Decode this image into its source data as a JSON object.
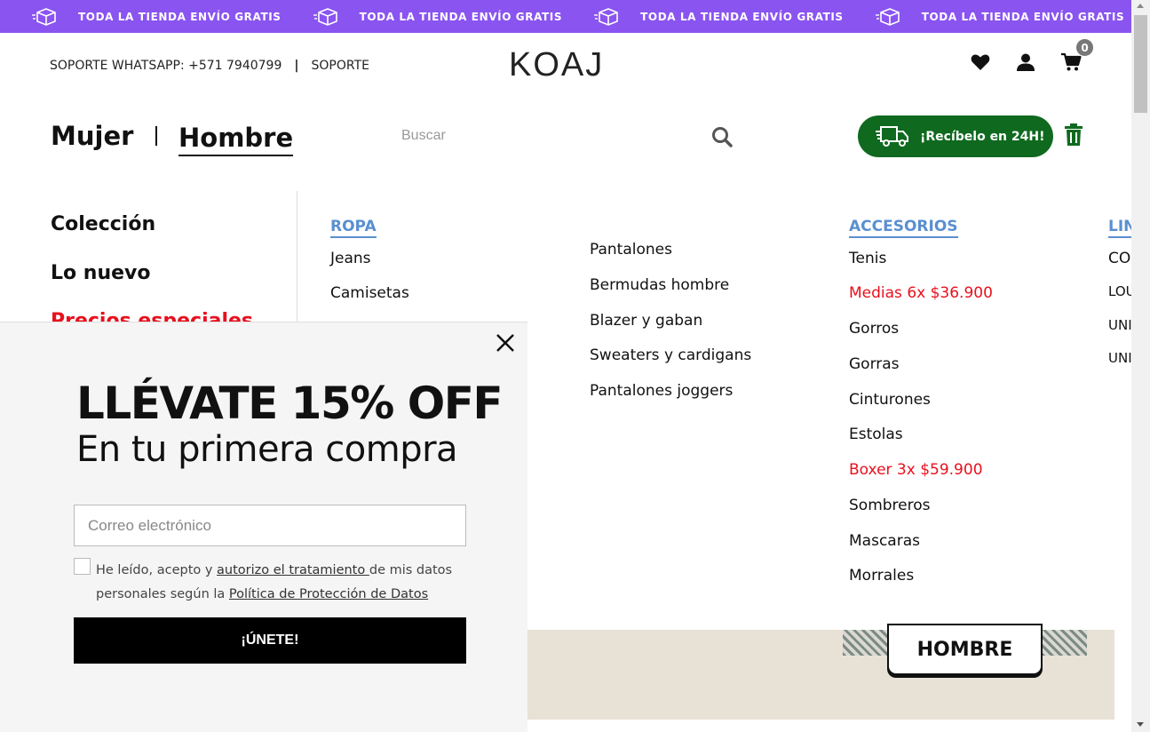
{
  "promo": {
    "items": [
      {
        "text": "TODA LA TIENDA ENVÍO GRATIS"
      },
      {
        "text": "TODA LA TIENDA ENVÍO GRATIS"
      },
      {
        "text": "TODA LA TIENDA ENVÍO GRATIS"
      },
      {
        "text": "TODA LA TIENDA ENVÍO GRATIS"
      }
    ],
    "background": "#8a54f0"
  },
  "header": {
    "support_whatsapp": "SOPORTE WHATSAPP: +571 7940799",
    "separator": "|",
    "support_link": "SOPORTE",
    "logo": "KOAJ",
    "cart_count": "0"
  },
  "nav": {
    "mujer": "Mujer",
    "hombre": "Hombre",
    "search_placeholder": "Buscar",
    "delivery_label": "¡Recíbelo en 24H!",
    "delivery_color": "#0f6a1f"
  },
  "sidebar": {
    "items": [
      {
        "label": "Colección"
      },
      {
        "label": "Lo nuevo"
      },
      {
        "label": "Precios especiales"
      }
    ]
  },
  "menu": {
    "ropa": {
      "heading": "ROPA",
      "col1": [
        "Jeans",
        "Camisetas"
      ],
      "col2": [
        "Pantalones",
        "Bermudas hombre",
        "Blazer y gaban",
        "Sweaters y cardigans",
        "Pantalones joggers"
      ]
    },
    "accesorios": {
      "heading": "ACCESORIOS",
      "items": [
        {
          "label": "Tenis",
          "highlight": false
        },
        {
          "label": "Medias 6x $36.900",
          "highlight": true
        },
        {
          "label": "Gorros",
          "highlight": false
        },
        {
          "label": "Gorras",
          "highlight": false
        },
        {
          "label": "Cinturones",
          "highlight": false
        },
        {
          "label": "Estolas",
          "highlight": false
        },
        {
          "label": "Boxer 3x $59.900",
          "highlight": true
        },
        {
          "label": "Sombreros",
          "highlight": false
        },
        {
          "label": "Mascaras",
          "highlight": false
        },
        {
          "label": "Morrales",
          "highlight": false
        }
      ]
    },
    "lineas": {
      "heading": "LIN",
      "items": [
        "CO",
        "LOU",
        "UNI",
        "UNI"
      ]
    },
    "heading_color": "#5a8fd0",
    "highlight_color": "#e8101e"
  },
  "banner": {
    "button_label": "HOMBRE"
  },
  "popup": {
    "title": "LLÉVATE 15% OFF",
    "subtitle": "En tu primera compra",
    "email_placeholder": "Correo electrónico",
    "legal_prefix": "He leído, acepto y ",
    "legal_link1": "autorizo el tratamiento ",
    "legal_mid": "de mis datos personales según la ",
    "legal_link2": "Política de Protección de Datos",
    "submit_label": "¡ÚNETE!"
  }
}
